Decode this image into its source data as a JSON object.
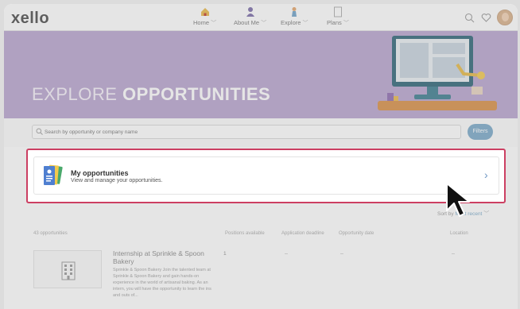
{
  "app": {
    "logo": "xello"
  },
  "nav": [
    {
      "label": "Home",
      "icon": "home-icon"
    },
    {
      "label": "About Me",
      "icon": "person-icon"
    },
    {
      "label": "Explore",
      "icon": "explore-person-icon"
    },
    {
      "label": "Plans",
      "icon": "document-icon"
    }
  ],
  "topbar_icons": [
    "search-icon",
    "heart-icon",
    "avatar"
  ],
  "hero": {
    "title_light": "EXPLORE ",
    "title_bold": "OPPORTUNITIES"
  },
  "search": {
    "placeholder": "Search by opportunity or company name",
    "filters_label": "Filters"
  },
  "my_opportunities": {
    "title": "My opportunities",
    "subtitle": "View and manage your opportunities."
  },
  "sort": {
    "label": "Sort by",
    "value": "Most recent"
  },
  "table": {
    "count_label": "43 opportunities",
    "headers": [
      "Positions available",
      "Application deadline",
      "Opportunity date",
      "Location"
    ],
    "rows": [
      {
        "title": "Internship at Sprinkle & Spoon Bakery",
        "description": "Sprinkle & Spoon Bakery Join the talented team at Sprinkle & Spoon Bakery and gain hands-on experience in the world of artisanal baking. As an intern, you will have the opportunity to learn the ins and outs of...",
        "positions": "1",
        "deadline": "–",
        "date": "–",
        "location": "–"
      }
    ]
  },
  "colors": {
    "hero": "#b9a4cf",
    "accent": "#7aa9c9",
    "highlight": "#cc3f62"
  }
}
